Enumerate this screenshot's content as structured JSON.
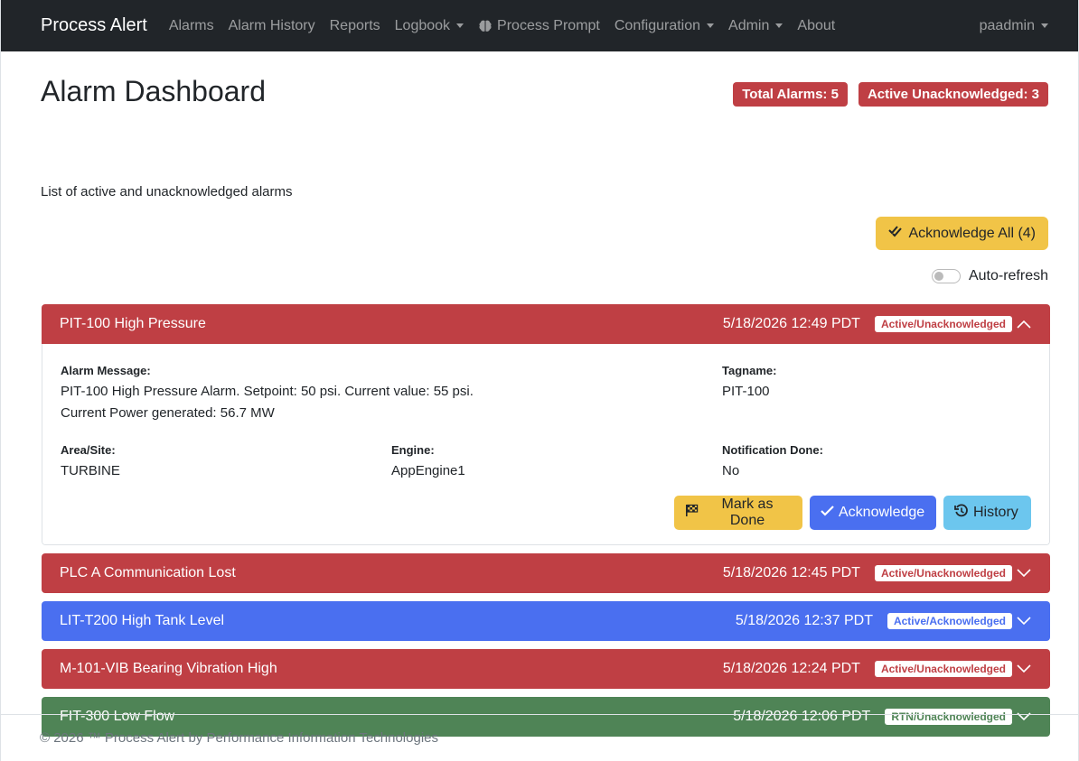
{
  "navbar": {
    "brand": "Process Alert",
    "items": [
      {
        "label": "Alarms",
        "dropdown": false
      },
      {
        "label": "Alarm History",
        "dropdown": false
      },
      {
        "label": "Reports",
        "dropdown": false
      },
      {
        "label": "Logbook",
        "dropdown": true
      },
      {
        "label": "Process Prompt",
        "dropdown": false,
        "icon": "brain-icon"
      },
      {
        "label": "Configuration",
        "dropdown": true
      },
      {
        "label": "Admin",
        "dropdown": true
      },
      {
        "label": "About",
        "dropdown": false
      }
    ],
    "user": "paadmin"
  },
  "page": {
    "title": "Alarm Dashboard",
    "subtitle": "List of active and unacknowledged alarms",
    "total_alarms": "Total Alarms: 5",
    "active_unack": "Active Unacknowledged: 3",
    "ack_all_label": "Acknowledge All (4)",
    "auto_refresh_label": "Auto-refresh",
    "auto_refresh_on": false
  },
  "alarms": [
    {
      "name": "PIT-100 High Pressure",
      "time": "5/18/2026 12:49 PDT",
      "state": "Active/Unacknowledged",
      "color": "#bf3f44",
      "expanded": true,
      "details": {
        "message_label": "Alarm Message:",
        "message_line1": "PIT-100 High Pressure Alarm. Setpoint: 50 psi. Current value: 55 psi.",
        "message_line2": "Current Power generated: 56.7 MW",
        "tagname_label": "Tagname:",
        "tagname": "PIT-100",
        "area_label": "Area/Site:",
        "area": "TURBINE",
        "engine_label": "Engine:",
        "engine": "AppEngine1",
        "notification_label": "Notification Done:",
        "notification": "No",
        "mark_done_label": "Mark as Done",
        "acknowledge_label": "Acknowledge",
        "history_label": "History"
      }
    },
    {
      "name": "PLC A Communication Lost",
      "time": "5/18/2026 12:45 PDT",
      "state": "Active/Unacknowledged",
      "color": "#bf3f44",
      "expanded": false
    },
    {
      "name": "LIT-T200 High Tank Level",
      "time": "5/18/2026 12:37 PDT",
      "state": "Active/Acknowledged",
      "color": "#4a6ff0",
      "expanded": false
    },
    {
      "name": "M-101-VIB Bearing Vibration High",
      "time": "5/18/2026 12:24 PDT",
      "state": "Active/Unacknowledged",
      "color": "#bf3f44",
      "expanded": false
    },
    {
      "name": "FIT-300 Low Flow",
      "time": "5/18/2026 12:06 PDT",
      "state": "RTN/Unacknowledged",
      "color": "#4f8456",
      "expanded": false
    }
  ],
  "footer": {
    "text": "© 2026 ™ Process Alert by Performance Information Technologies"
  }
}
